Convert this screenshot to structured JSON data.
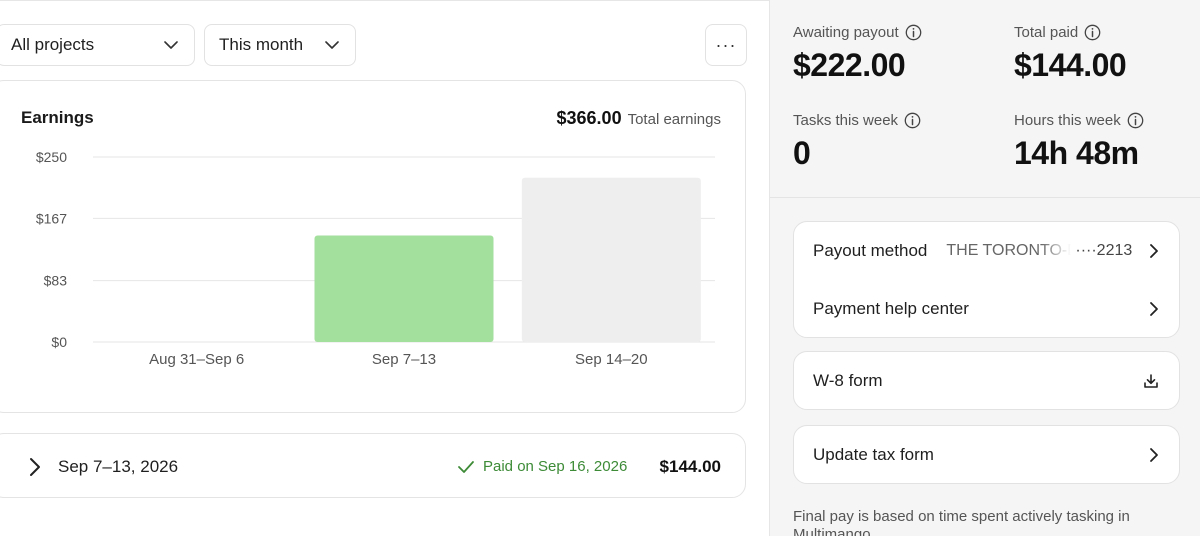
{
  "filters": {
    "project": "All projects",
    "range": "This month"
  },
  "more_label": "···",
  "earnings": {
    "title": "Earnings",
    "total": "$366.00",
    "total_label": "Total earnings"
  },
  "chart_data": {
    "type": "bar",
    "categories": [
      "Aug 31–Sep 6",
      "Sep 7–13",
      "Sep 14–20"
    ],
    "values": [
      0,
      144,
      222
    ],
    "bar_colors": [
      "#a3df9d",
      "#a3df9d",
      "#eeeeee"
    ],
    "y_ticks": [
      "$0",
      "$83",
      "$167",
      "$250"
    ],
    "y_tick_values": [
      0,
      83,
      167,
      250
    ],
    "ylim": [
      0,
      250
    ],
    "grid": true,
    "title": "",
    "xlabel": "",
    "ylabel": ""
  },
  "payment_row": {
    "period": "Sep 7–13, 2026",
    "status": "Paid on Sep 16, 2026",
    "amount": "$144.00"
  },
  "stats": [
    {
      "label": "Awaiting payout",
      "value": "$222.00"
    },
    {
      "label": "Total paid",
      "value": "$144.00"
    },
    {
      "label": "Tasks this week",
      "value": "0"
    },
    {
      "label": "Hours this week",
      "value": "14h 48m"
    }
  ],
  "payout": {
    "label": "Payout method",
    "bank": "THE TORONTO-DOMINION",
    "mask": "····2213"
  },
  "help_center": "Payment help center",
  "w8_form": "W-8 form",
  "update_tax": "Update tax form",
  "footnote": "Final pay is based on time spent actively tasking in Multimango",
  "colors": {
    "paid_green": "#3d8b37",
    "bar_green": "#a3df9d",
    "bar_gray": "#eeeeee"
  },
  "icons": [
    "chevron-down-icon",
    "more-icon",
    "chevron-right-icon",
    "check-icon",
    "info-icon",
    "download-icon"
  ]
}
